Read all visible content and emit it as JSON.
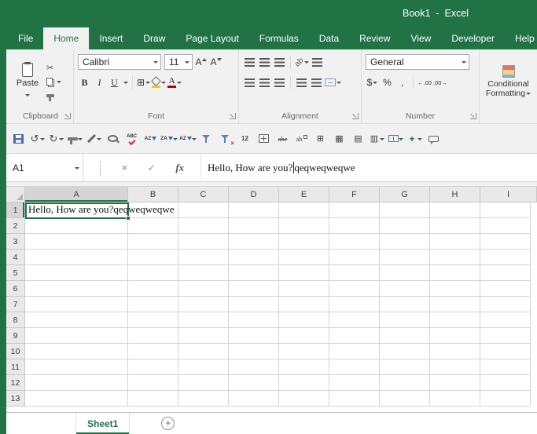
{
  "window": {
    "title": "Book1  -  Excel"
  },
  "theme": {
    "accent_green": "#217346",
    "font_color_red": "#c00000",
    "fill_color_yellow": "#f2c811"
  },
  "ribbon_tabs": [
    {
      "label": "File",
      "active": false
    },
    {
      "label": "Home",
      "active": true
    },
    {
      "label": "Insert",
      "active": false
    },
    {
      "label": "Draw",
      "active": false
    },
    {
      "label": "Page Layout",
      "active": false
    },
    {
      "label": "Formulas",
      "active": false
    },
    {
      "label": "Data",
      "active": false
    },
    {
      "label": "Review",
      "active": false
    },
    {
      "label": "View",
      "active": false
    },
    {
      "label": "Developer",
      "active": false
    },
    {
      "label": "Help",
      "active": false
    }
  ],
  "ribbon": {
    "clipboard": {
      "label": "Clipboard",
      "paste_label": "Paste",
      "cut_glyph": "✂"
    },
    "font": {
      "label": "Font",
      "font_name": "Calibri",
      "font_size": "11",
      "grow_glyph": "A",
      "shrink_glyph": "A",
      "bold_glyph": "B",
      "italic_glyph": "I",
      "underline_glyph": "U",
      "borders_glyph": "⊞",
      "font_color_glyph": "A"
    },
    "alignment": {
      "label": "Alignment",
      "orientation_glyph": "ab"
    },
    "number": {
      "label": "Number",
      "format_value": "General",
      "accounting_glyph": "$",
      "percent_glyph": "%",
      "comma_glyph": ",",
      "increase_decimal_glyph": "←.00",
      "decrease_decimal_glyph": ".00→"
    },
    "styles": {
      "conditional_line1": "Conditional",
      "conditional_line2": "Formatting"
    }
  },
  "quick_access": {
    "buttons": [
      {
        "name": "save-button",
        "css": "i-floppy"
      },
      {
        "name": "undo-button",
        "css": "i-arrow",
        "glyph": "↺",
        "dropdown": true
      },
      {
        "name": "redo-button",
        "css": "i-arrow",
        "glyph": "↻",
        "dropdown": true
      },
      {
        "name": "format-painter-button",
        "css": "i-brush",
        "dropdown": true
      },
      {
        "name": "draw-border-button",
        "css": "i-pen",
        "dropdown": true
      },
      {
        "name": "print-preview-button",
        "css": "i-zoom"
      },
      {
        "name": "spelling-button",
        "css": "i-spell",
        "glyph": "ABC"
      },
      {
        "name": "sort-ascending-button",
        "css": "i-sort",
        "glyph": "AZ"
      },
      {
        "name": "sort-descending-button",
        "css": "i-sort",
        "glyph": "ZA",
        "dropdown": true
      },
      {
        "name": "custom-sort-button",
        "css": "i-sort",
        "glyph": "AZ",
        "dropdown": true
      },
      {
        "name": "filter-button",
        "css": "i-funnel"
      },
      {
        "name": "clear-filter-button",
        "css": "i-funnel",
        "overlay": "×"
      },
      {
        "name": "font-size-button",
        "css": "i-12",
        "glyph": "12"
      },
      {
        "name": "calculator-button",
        "css": "i-calc"
      },
      {
        "name": "strikethrough-button",
        "css": "i-strike",
        "glyph": "abe"
      },
      {
        "name": "superscript-button",
        "css": "i-sup",
        "glyph": "ab"
      },
      {
        "name": "all-borders-button",
        "glyph": "⊞"
      },
      {
        "name": "thick-borders-button",
        "glyph": "▦"
      },
      {
        "name": "top-border-button",
        "glyph": "▤"
      },
      {
        "name": "bottom-border-button",
        "glyph": "▥",
        "dropdown": true
      },
      {
        "name": "merge-cells-button",
        "css": "i-merge",
        "dropdown": true
      },
      {
        "name": "insert-cells-button",
        "css": "i-plus",
        "glyph": "+",
        "dropdown": true
      },
      {
        "name": "new-comment-button",
        "css": "i-bubble"
      }
    ]
  },
  "formula_bar": {
    "name_box": "A1",
    "cancel_glyph": "×",
    "enter_glyph": "✓",
    "fx_glyph": "fx",
    "value_before_cursor": "Hello, How are you?",
    "value_after_cursor": "qeqweqweqwe"
  },
  "grid": {
    "columns": [
      "A",
      "B",
      "C",
      "D",
      "E",
      "F",
      "G",
      "H",
      "I"
    ],
    "rows": [
      "1",
      "2",
      "3",
      "4",
      "5",
      "6",
      "7",
      "8",
      "9",
      "10",
      "11",
      "12",
      "13"
    ],
    "selected_column": "A",
    "selected_row": "1",
    "active_cell": "A1",
    "cells": {
      "A1": "Hello, How are you?qeqweqweqwe"
    }
  },
  "sheet_bar": {
    "tabs": [
      {
        "label": "Sheet1",
        "active": true
      }
    ],
    "add_tab_glyph": "+"
  }
}
